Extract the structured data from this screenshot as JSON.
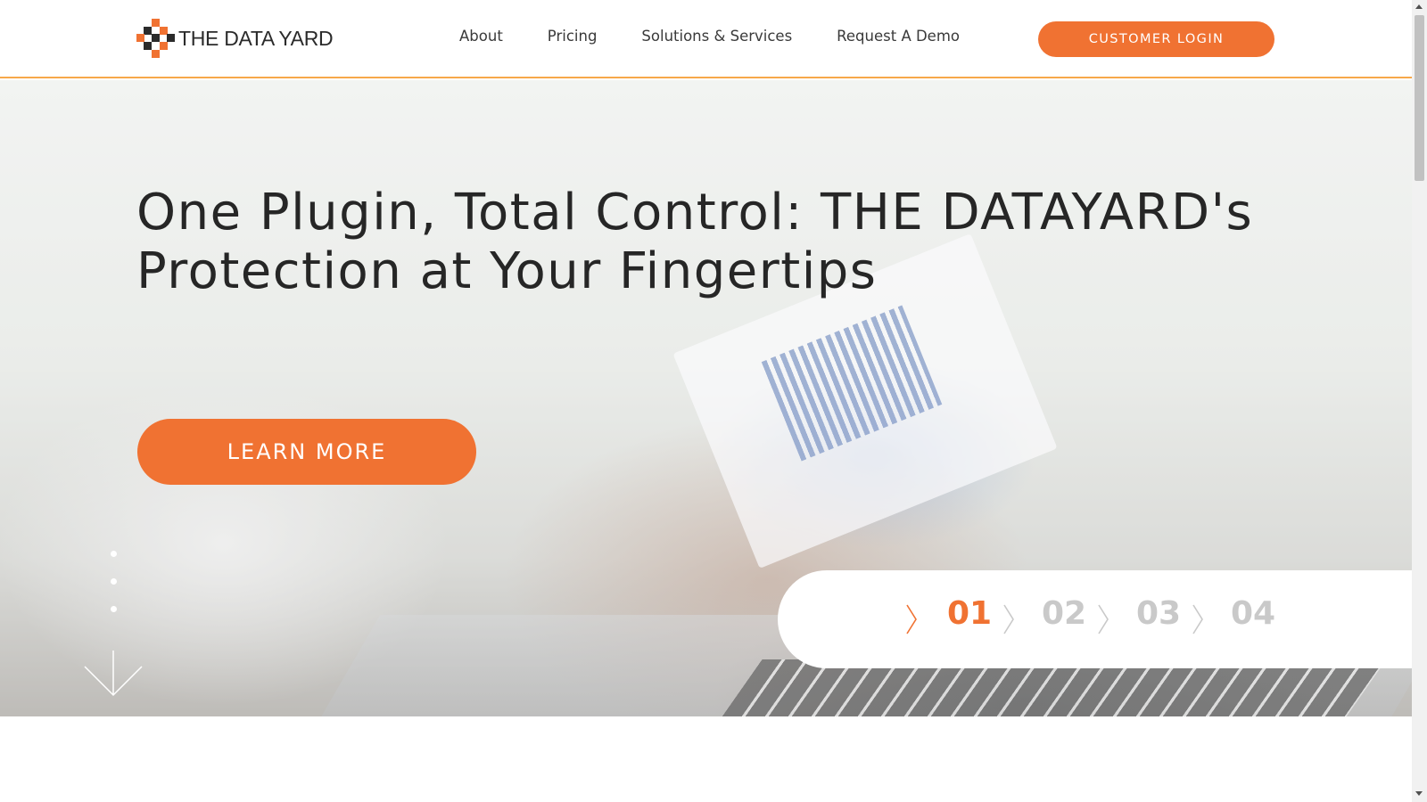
{
  "header": {
    "logo_text": "THE DATA YARD",
    "nav": [
      "About",
      "Pricing",
      "Solutions & Services",
      "Request A Demo"
    ],
    "login_label": "CUSTOMER LOGIN"
  },
  "hero": {
    "title": "One Plugin, Total Control: THE DATAYARD's Protection at Your Fingertips",
    "cta_label": "LEARN MORE",
    "slides": [
      "01",
      "02",
      "03",
      "04"
    ],
    "active_slide": "01"
  },
  "section": {
    "partial_heading": ""
  },
  "colors": {
    "accent": "#f07232",
    "header_border": "#f7a84a",
    "inactive_slide": "#c9c9c9",
    "logo_dark": "#2b2b2b"
  },
  "icons": [
    "logo-mark-icon",
    "chevron-right-icon",
    "scroll-down-arrow-icon",
    "scroll-up-icon",
    "scroll-down-icon"
  ]
}
